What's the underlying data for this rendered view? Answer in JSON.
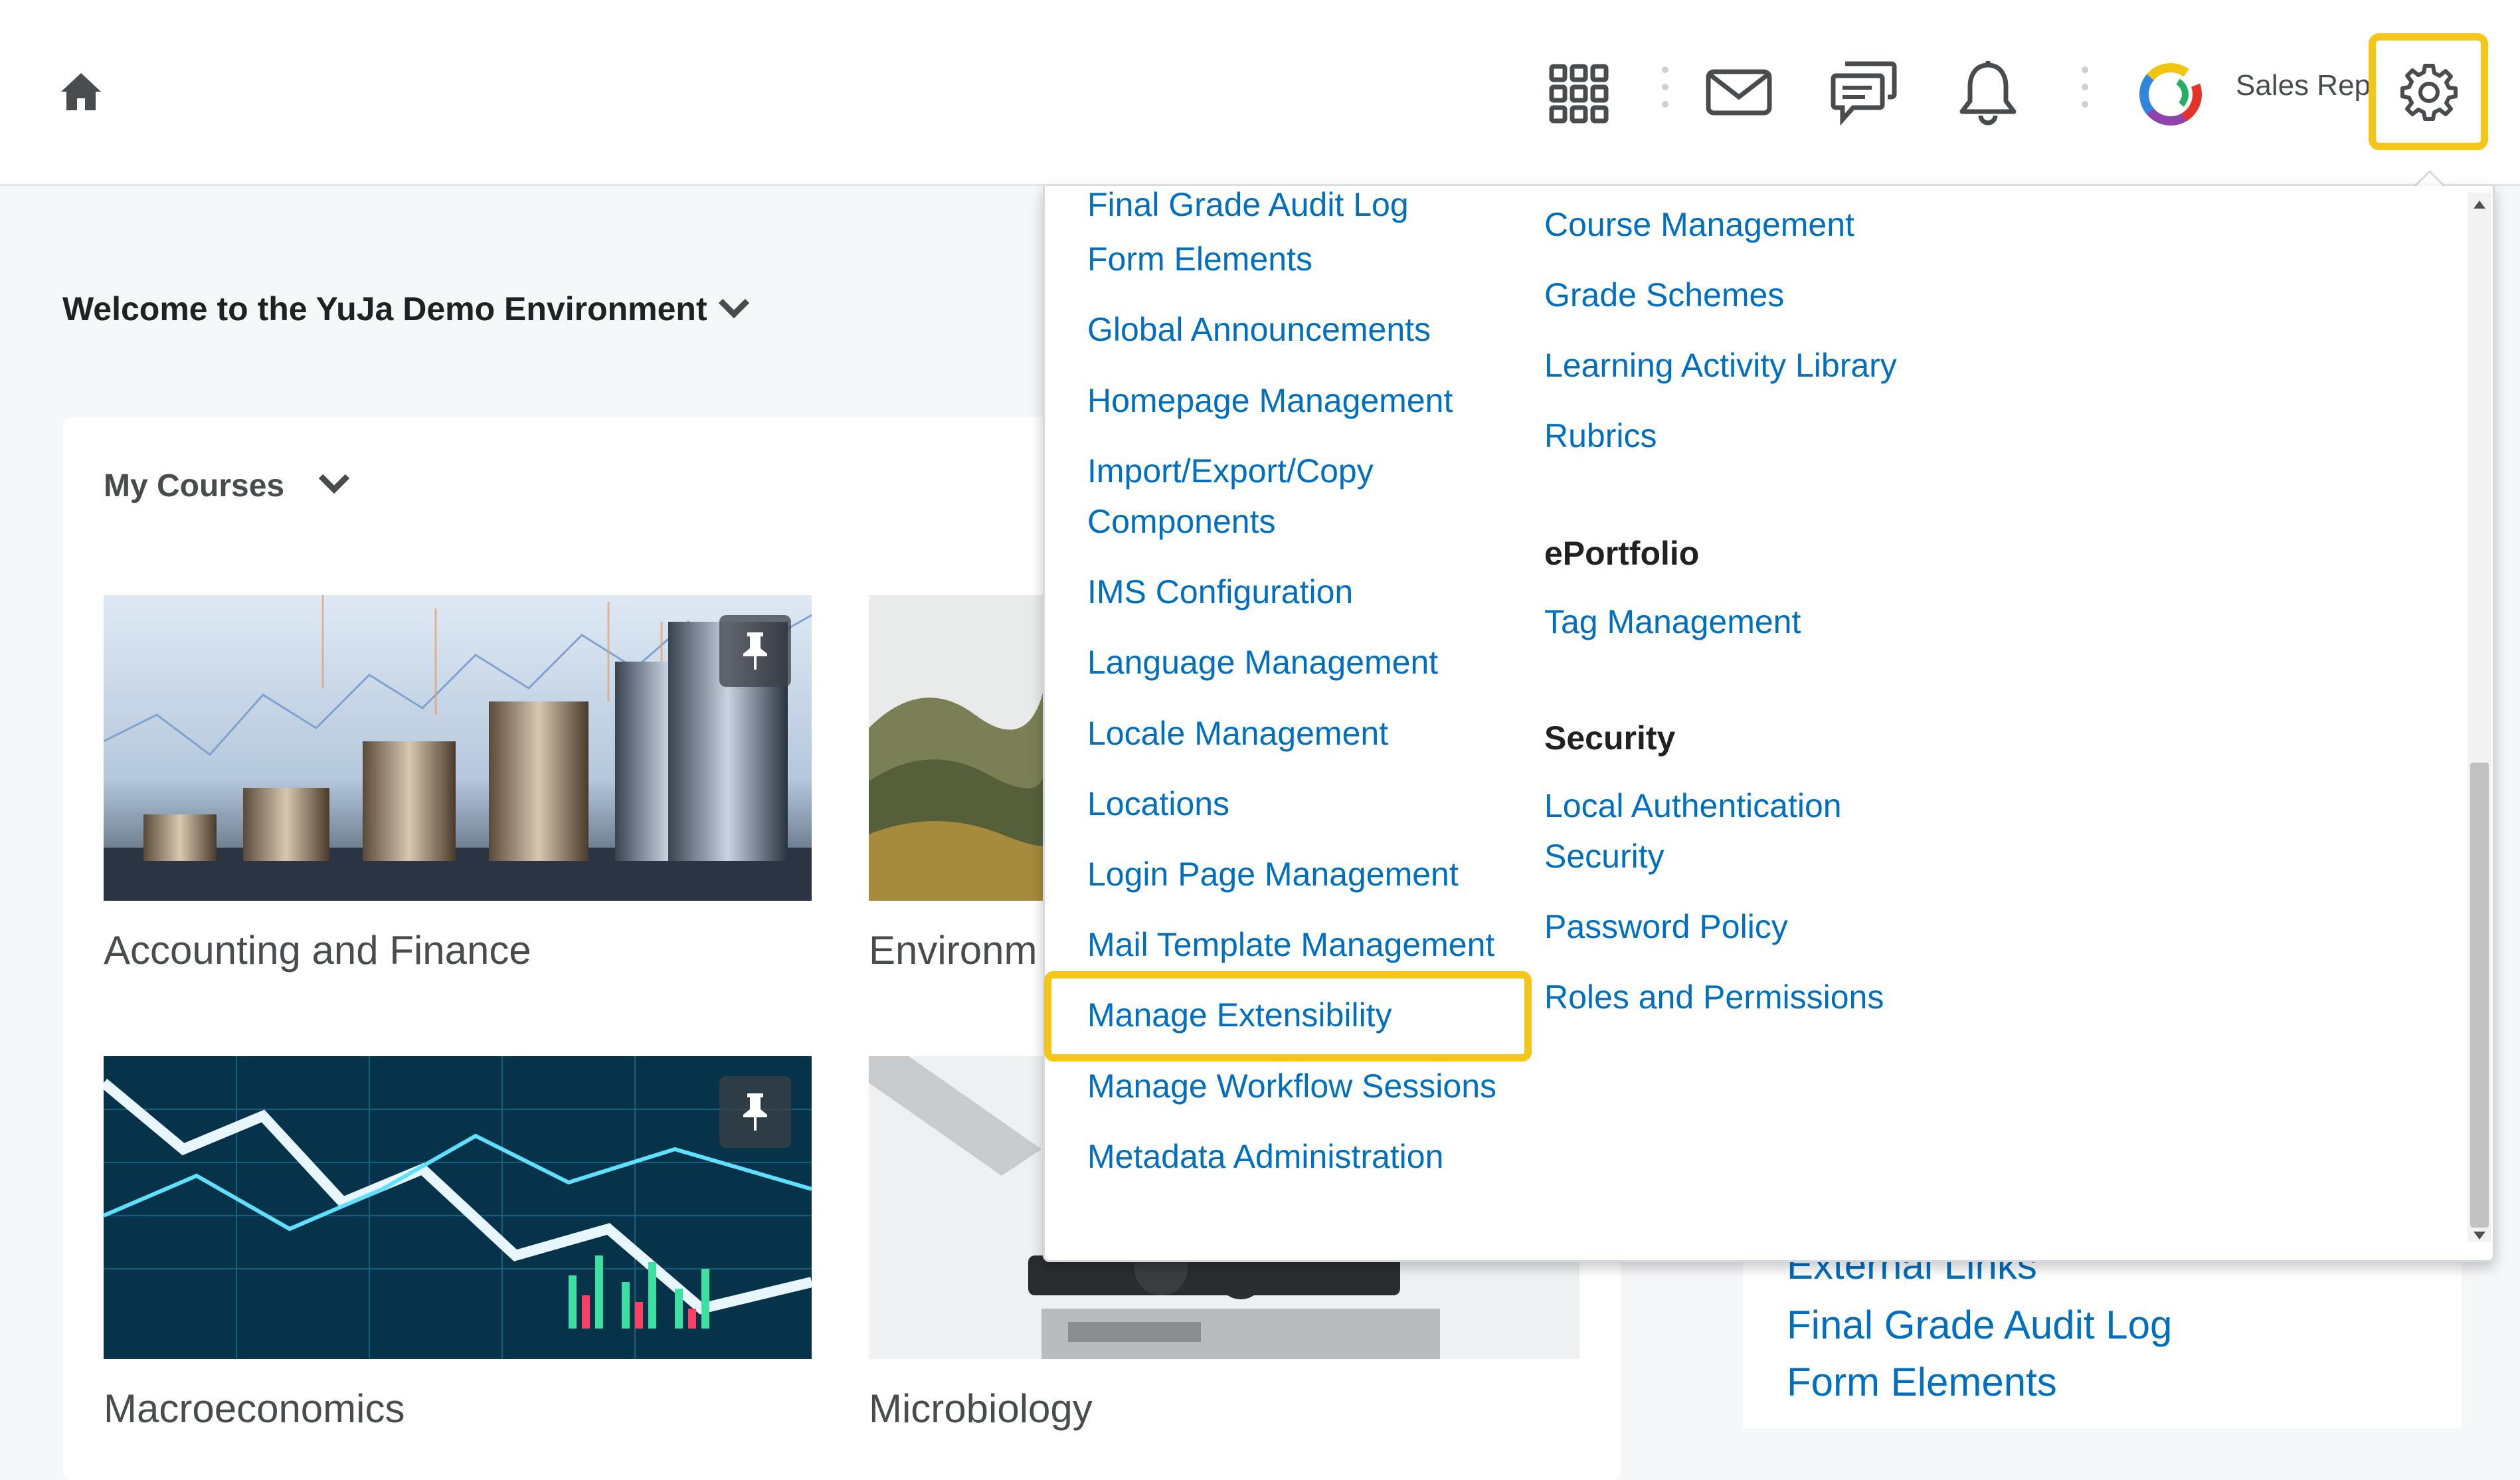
{
  "topbar": {
    "user_name": "Sales Rep",
    "icons": [
      "home-icon",
      "waffle-icon",
      "mail-icon",
      "chat-icon",
      "bell-icon",
      "gear-icon"
    ]
  },
  "page": {
    "welcome": "Welcome to the YuJa Demo Environment",
    "my_courses": "My Courses",
    "courses": [
      {
        "name": "Accounting and Finance"
      },
      {
        "name": "Environm"
      },
      {
        "name": "Macroeconomics"
      },
      {
        "name": "Microbiology"
      }
    ],
    "behind_links": [
      "External Links",
      "Final Grade Audit Log",
      "Form Elements"
    ]
  },
  "dropdown": {
    "col1_cut": "Final Grade Audit Log",
    "col1": [
      "Form Elements",
      "Global Announcements",
      "Homepage Management",
      "Import/Export/Copy",
      "Components",
      "IMS Configuration",
      "Language Management",
      "Locale Management",
      "Locations",
      "Login Page Management",
      "Mail Template Management",
      "Manage Extensibility",
      "Manage Workflow Sessions",
      "Metadata Administration"
    ],
    "col2_top": [
      "Course Management",
      "Grade Schemes",
      "Learning Activity Library",
      "Rubrics"
    ],
    "eportfolio_heading": "ePortfolio",
    "eportfolio": [
      "Tag Management"
    ],
    "security_heading": "Security",
    "security": [
      "Local Authentication",
      "Security",
      "Password Policy",
      "Roles and Permissions"
    ]
  },
  "colors": {
    "link": "#006fbf",
    "highlight": "#f5c518"
  }
}
